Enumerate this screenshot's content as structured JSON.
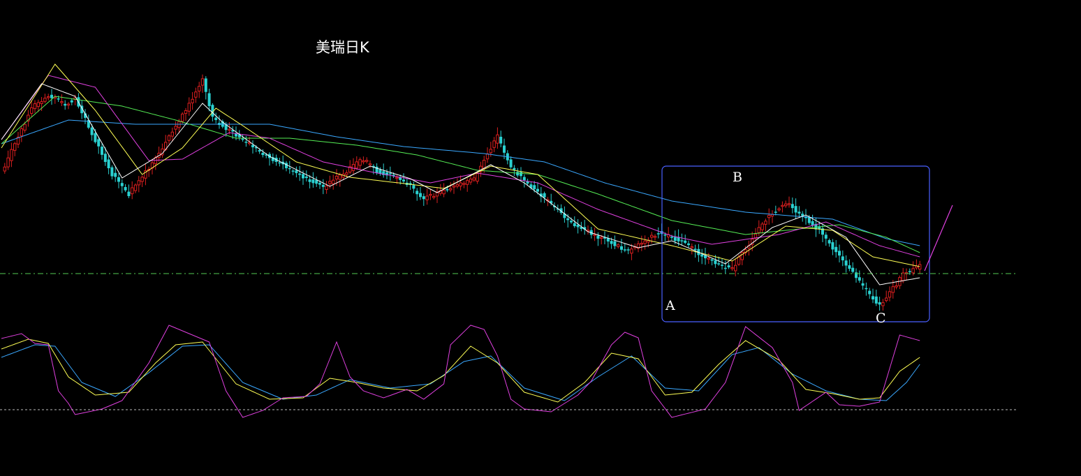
{
  "title": "美瑞日K",
  "colors": {
    "background": "#000000",
    "candle_up": "#dd1f1f",
    "candle_down": "#2ad1d1",
    "ma5": "#ffffff",
    "ma10": "#ffff55",
    "ma20": "#e040e0",
    "ma30": "#55ee55",
    "ma60": "#3aa8ff",
    "kdj_k": "#ffffff",
    "kdj_d": "#ffff55",
    "kdj_j": "#e040e0",
    "ref_line": "#55cc55",
    "baseline": "#bbbbbb",
    "box": "#4a5fff",
    "arrow": "#e040e0"
  },
  "annotations": {
    "point_a": "A",
    "point_b": "B",
    "point_c": "C"
  },
  "chart_data": [
    {
      "type": "candlestick",
      "title": "美瑞日K",
      "series": [
        {
          "name": "price",
          "anchors": [
            [
              0,
              248
            ],
            [
              9,
              155
            ],
            [
              14,
              137
            ],
            [
              19,
              149
            ],
            [
              22,
              142
            ],
            [
              33,
              250
            ],
            [
              38,
              278
            ],
            [
              46,
              227
            ],
            [
              56,
              149
            ],
            [
              60,
              114
            ],
            [
              63,
              170
            ],
            [
              78,
              220
            ],
            [
              96,
              269
            ],
            [
              108,
              228
            ],
            [
              112,
              246
            ],
            [
              119,
              255
            ],
            [
              126,
              284
            ],
            [
              141,
              257
            ],
            [
              148,
              195
            ],
            [
              152,
              240
            ],
            [
              171,
              323
            ],
            [
              187,
              360
            ],
            [
              196,
              333
            ],
            [
              202,
              344
            ],
            [
              213,
              378
            ],
            [
              218,
              385
            ],
            [
              228,
              314
            ],
            [
              234,
              290
            ],
            [
              244,
              330
            ],
            [
              258,
              416
            ],
            [
              262,
              438
            ],
            [
              266,
              413
            ],
            [
              269,
              394
            ],
            [
              274,
              380
            ]
          ]
        },
        {
          "name": "ma_short",
          "anchors": [
            [
              0,
              200
            ],
            [
              12,
              120
            ],
            [
              22,
              138
            ],
            [
              36,
              255
            ],
            [
              48,
              220
            ],
            [
              60,
              148
            ],
            [
              66,
              175
            ],
            [
              80,
              224
            ],
            [
              98,
              267
            ],
            [
              110,
              238
            ],
            [
              122,
              256
            ],
            [
              130,
              276
            ],
            [
              146,
              236
            ],
            [
              156,
              262
            ],
            [
              175,
              332
            ],
            [
              190,
              355
            ],
            [
              200,
              345
            ],
            [
              216,
              378
            ],
            [
              230,
              326
            ],
            [
              240,
              308
            ],
            [
              252,
              340
            ],
            [
              262,
              408
            ],
            [
              274,
              398
            ]
          ]
        },
        {
          "name": "ma_mid",
          "anchors": [
            [
              0,
              212
            ],
            [
              16,
              92
            ],
            [
              28,
              158
            ],
            [
              42,
              250
            ],
            [
              54,
              212
            ],
            [
              64,
              155
            ],
            [
              72,
              180
            ],
            [
              88,
              232
            ],
            [
              104,
              254
            ],
            [
              122,
              264
            ],
            [
              132,
              270
            ],
            [
              146,
              238
            ],
            [
              160,
              250
            ],
            [
              178,
              328
            ],
            [
              200,
              352
            ],
            [
              218,
              374
            ],
            [
              234,
              324
            ],
            [
              248,
              330
            ],
            [
              260,
              368
            ],
            [
              274,
              382
            ]
          ]
        },
        {
          "name": "ma_long",
          "anchors": [
            [
              0,
              200
            ],
            [
              14,
              108
            ],
            [
              28,
              125
            ],
            [
              44,
              230
            ],
            [
              54,
              228
            ],
            [
              68,
              190
            ],
            [
              80,
              198
            ],
            [
              96,
              232
            ],
            [
              110,
              246
            ],
            [
              128,
              262
            ],
            [
              142,
              248
            ],
            [
              160,
              262
            ],
            [
              178,
              300
            ],
            [
              200,
              338
            ],
            [
              212,
              350
            ],
            [
              232,
              336
            ],
            [
              246,
              318
            ],
            [
              262,
              352
            ],
            [
              274,
              368
            ]
          ]
        },
        {
          "name": "ma_xlong",
          "anchors": [
            [
              0,
              206
            ],
            [
              16,
              138
            ],
            [
              36,
              152
            ],
            [
              52,
              172
            ],
            [
              70,
              198
            ],
            [
              86,
              198
            ],
            [
              106,
              208
            ],
            [
              124,
              222
            ],
            [
              142,
              244
            ],
            [
              160,
              250
            ],
            [
              178,
              278
            ],
            [
              200,
              316
            ],
            [
              222,
              336
            ],
            [
              250,
              322
            ],
            [
              264,
              340
            ],
            [
              274,
              362
            ]
          ]
        },
        {
          "name": "ma_xxlong",
          "anchors": [
            [
              0,
              206
            ],
            [
              20,
              172
            ],
            [
              40,
              178
            ],
            [
              60,
              178
            ],
            [
              80,
              178
            ],
            [
              100,
              196
            ],
            [
              120,
              210
            ],
            [
              144,
              220
            ],
            [
              162,
              232
            ],
            [
              180,
              262
            ],
            [
              200,
              288
            ],
            [
              222,
              304
            ],
            [
              248,
              314
            ],
            [
              264,
              342
            ],
            [
              274,
              352
            ]
          ]
        },
        {
          "name": "kdj_j",
          "anchors": [
            [
              0,
              485
            ],
            [
              6,
              478
            ],
            [
              10,
              492
            ],
            [
              14,
              494
            ],
            [
              17,
              560
            ],
            [
              20,
              578
            ],
            [
              22,
              594
            ],
            [
              30,
              586
            ],
            [
              36,
              574
            ],
            [
              44,
              520
            ],
            [
              50,
              466
            ],
            [
              56,
              478
            ],
            [
              62,
              490
            ],
            [
              67,
              560
            ],
            [
              72,
              598
            ],
            [
              78,
              588
            ],
            [
              84,
              570
            ],
            [
              91,
              568
            ],
            [
              95,
              550
            ],
            [
              100,
              490
            ],
            [
              104,
              540
            ],
            [
              108,
              560
            ],
            [
              114,
              570
            ],
            [
              121,
              558
            ],
            [
              126,
              572
            ],
            [
              132,
              550
            ],
            [
              134,
              494
            ],
            [
              140,
              466
            ],
            [
              144,
              472
            ],
            [
              148,
              510
            ],
            [
              152,
              572
            ],
            [
              156,
              586
            ],
            [
              164,
              590
            ],
            [
              172,
              566
            ],
            [
              176,
              546
            ],
            [
              182,
              494
            ],
            [
              186,
              476
            ],
            [
              190,
              484
            ],
            [
              194,
              560
            ],
            [
              200,
              598
            ],
            [
              210,
              586
            ],
            [
              216,
              548
            ],
            [
              222,
              468
            ],
            [
              230,
              498
            ],
            [
              236,
              548
            ],
            [
              238,
              588
            ],
            [
              246,
              562
            ],
            [
              250,
              580
            ],
            [
              256,
              582
            ],
            [
              262,
              576
            ],
            [
              268,
              480
            ],
            [
              274,
              488
            ]
          ]
        },
        {
          "name": "kdj_k",
          "anchors": [
            [
              0,
              500
            ],
            [
              8,
              486
            ],
            [
              14,
              492
            ],
            [
              20,
              540
            ],
            [
              28,
              566
            ],
            [
              38,
              562
            ],
            [
              46,
              520
            ],
            [
              52,
              494
            ],
            [
              60,
              490
            ],
            [
              70,
              550
            ],
            [
              80,
              572
            ],
            [
              90,
              570
            ],
            [
              98,
              542
            ],
            [
              106,
              548
            ],
            [
              114,
              556
            ],
            [
              124,
              560
            ],
            [
              132,
              538
            ],
            [
              140,
              496
            ],
            [
              148,
              520
            ],
            [
              156,
              562
            ],
            [
              166,
              576
            ],
            [
              174,
              548
            ],
            [
              182,
              506
            ],
            [
              190,
              514
            ],
            [
              198,
              566
            ],
            [
              206,
              562
            ],
            [
              214,
              522
            ],
            [
              222,
              488
            ],
            [
              232,
              516
            ],
            [
              240,
              558
            ],
            [
              248,
              564
            ],
            [
              256,
              572
            ],
            [
              262,
              570
            ],
            [
              268,
              532
            ],
            [
              274,
              512
            ]
          ]
        },
        {
          "name": "kdj_d",
          "anchors": [
            [
              0,
              512
            ],
            [
              10,
              494
            ],
            [
              16,
              496
            ],
            [
              24,
              548
            ],
            [
              34,
              568
            ],
            [
              44,
              534
            ],
            [
              54,
              496
            ],
            [
              62,
              494
            ],
            [
              72,
              548
            ],
            [
              84,
              572
            ],
            [
              94,
              566
            ],
            [
              104,
              544
            ],
            [
              116,
              556
            ],
            [
              128,
              550
            ],
            [
              138,
              518
            ],
            [
              146,
              510
            ],
            [
              156,
              556
            ],
            [
              168,
              574
            ],
            [
              178,
              540
            ],
            [
              188,
              510
            ],
            [
              198,
              556
            ],
            [
              208,
              560
            ],
            [
              218,
              508
            ],
            [
              226,
              498
            ],
            [
              236,
              536
            ],
            [
              246,
              560
            ],
            [
              256,
              572
            ],
            [
              264,
              574
            ],
            [
              270,
              548
            ],
            [
              274,
              522
            ]
          ]
        }
      ]
    }
  ]
}
